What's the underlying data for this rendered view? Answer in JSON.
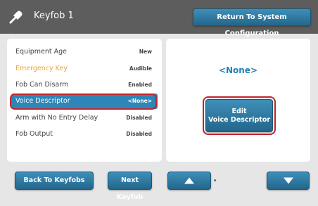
{
  "header": {
    "title": "Keyfob 1",
    "return_label": "Return To System Configuration"
  },
  "list": [
    {
      "label": "Equipment Age",
      "value": "New"
    },
    {
      "label": "Emergency Key",
      "value": "Audible"
    },
    {
      "label": "Fob Can Disarm",
      "value": "Enabled"
    },
    {
      "label": "Voice Descriptor",
      "value": "<None>"
    },
    {
      "label": "Arm with No Entry Delay",
      "value": "Disabled"
    },
    {
      "label": "Fob Output",
      "value": "Disabled"
    }
  ],
  "detail": {
    "value": "<None>",
    "edit_line1": "Edit",
    "edit_line2": "Voice Descriptor"
  },
  "footer": {
    "back_label": "Back To Keyfobs",
    "next_label": "Next Keyfob",
    "up_icon": "up-arrow-icon",
    "down_icon": "down-arrow-icon"
  },
  "colors": {
    "accent": "#2e86b8",
    "warning_text": "#f0a33a",
    "highlight_outline": "#c0272d",
    "header_bg": "#5d5d5d"
  }
}
